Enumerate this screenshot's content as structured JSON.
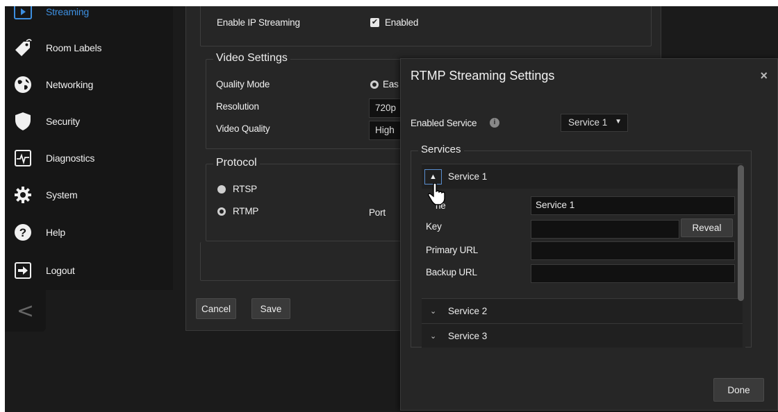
{
  "sidebar": {
    "items": [
      {
        "label": "Streaming",
        "icon": "play-icon"
      },
      {
        "label": "Room Labels",
        "icon": "tag-icon"
      },
      {
        "label": "Networking",
        "icon": "globe-icon"
      },
      {
        "label": "Security",
        "icon": "shield-icon"
      },
      {
        "label": "Diagnostics",
        "icon": "pulse-icon"
      },
      {
        "label": "System",
        "icon": "gear-icon"
      },
      {
        "label": "Help",
        "icon": "help-icon"
      },
      {
        "label": "Logout",
        "icon": "logout-icon"
      }
    ],
    "active_color": "#3d8fe0",
    "collapse_symbol": "<"
  },
  "main": {
    "ip_streaming": {
      "label": "Enable IP Streaming",
      "checkbox_label": "Enabled",
      "checked": true
    },
    "video_settings": {
      "legend": "Video Settings",
      "quality_mode_label": "Quality Mode",
      "quality_mode_value": "Eas",
      "resolution_label": "Resolution",
      "resolution_value": "720p",
      "video_quality_label": "Video Quality",
      "video_quality_value": "High"
    },
    "protocol": {
      "legend": "Protocol",
      "options": [
        "RTSP",
        "RTMP"
      ],
      "selected": "RTMP",
      "port_label": "Port"
    },
    "cancel_label": "Cancel",
    "save_label": "Save"
  },
  "modal": {
    "title": "RTMP Streaming Settings",
    "close_symbol": "×",
    "enabled_service_label": "Enabled Service",
    "enabled_service_value": "Service 1",
    "services_legend": "Services",
    "services": [
      {
        "label": "Service 1",
        "expanded": true
      },
      {
        "label": "Service 2",
        "expanded": false
      },
      {
        "label": "Service 3",
        "expanded": false
      }
    ],
    "fields": {
      "name_label": "ne",
      "name_value": "Service 1",
      "key_label": "Key",
      "key_value": "",
      "reveal_label": "Reveal",
      "primary_url_label": "Primary URL",
      "primary_url_value": "",
      "backup_url_label": "Backup URL",
      "backup_url_value": ""
    },
    "done_label": "Done"
  }
}
